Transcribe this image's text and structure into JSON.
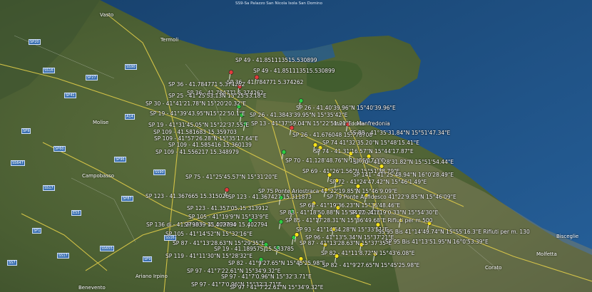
{
  "map": {
    "top_caption": "SS9-Sa Palazzo San Nicola Isola San Domino",
    "colors": {
      "sea": "#1f4f80",
      "land": "#4d6238",
      "road_yellow": "#e8d24a",
      "pin_green": "#2ecc40",
      "pin_red": "#e23b3b",
      "pin_yellow": "#f4e21a"
    },
    "towns": [
      {
        "id": "vasto",
        "text": "Vasto"
      },
      {
        "id": "termoli",
        "text": "Termoli"
      },
      {
        "id": "molise",
        "text": "Molise"
      },
      {
        "id": "campobasso",
        "text": "Campobasso"
      },
      {
        "id": "ariano",
        "text": "Ariano Irpino"
      },
      {
        "id": "benevento",
        "text": "Benevento"
      },
      {
        "id": "molfetta",
        "text": "Molfetta"
      },
      {
        "id": "corato",
        "text": "Corato"
      },
      {
        "id": "manfredonia",
        "text": "Manfredonia"
      },
      {
        "id": "bisceglie",
        "text": "Bisceglie"
      }
    ],
    "labels": [
      {
        "id": "l1",
        "text": "SP 49 - 41.851113515.530899"
      },
      {
        "id": "l2",
        "text": "SP 49 - 41.851113515.530899"
      },
      {
        "id": "l3",
        "text": "SP 36 - 41.784771 5.374262"
      },
      {
        "id": "l4",
        "text": "SP 36 - 41.784771 5.374262"
      },
      {
        "id": "l5",
        "text": "SP 36 - 41.784771 5.374262"
      },
      {
        "id": "l6",
        "text": "SP 25 - 41°25'53.13N 15°25'53.18\"E"
      },
      {
        "id": "l7",
        "text": "SP 30 - 41°41'21.78\"N 15°20'20.32\"E"
      },
      {
        "id": "l8",
        "text": "SP 26 - 41.40'39.96\"N 15°40'39.96\"E"
      },
      {
        "id": "l9",
        "text": "SP 19 - 41°39'43.95\"N15°22'50.1\"E"
      },
      {
        "id": "l10",
        "text": "SP 26 - 41.3843'39.95\"N 15°35'42\"E"
      },
      {
        "id": "l11",
        "text": "SP 19 - 41°31'45.05\"N 15°22'37.55\"E"
      },
      {
        "id": "l12",
        "text": "SP 13 - 41°37'59.04\"N 15°22'51.21\"E"
      },
      {
        "id": "l13",
        "text": "Manfredonia"
      },
      {
        "id": "l14",
        "text": "SP 109 - 41.581683 15.359703"
      },
      {
        "id": "l15",
        "text": "SP 26 - 41.676048 15.778708"
      },
      {
        "id": "l16",
        "text": "SS 88 - 41°35'31.84\"N 15°51'47.34\"E"
      },
      {
        "id": "l17",
        "text": "SP 109 - 41°57'26.28\"N 15°35'17.64\"E"
      },
      {
        "id": "l18",
        "text": "SP 109 - 41.585416 15.360139"
      },
      {
        "id": "l19",
        "text": "SP 74 41°32'35.20\"N 15°48'15.41\"E"
      },
      {
        "id": "l20",
        "text": "SP 109 - 41.556217 15.348979"
      },
      {
        "id": "l21",
        "text": "SP 74 - 41.31'16.57\"N 15°44'17.87\"E"
      },
      {
        "id": "l22",
        "text": "SP 70 - 41.128'48.76\"N 15°55'17.3\"E"
      },
      {
        "id": "l23",
        "text": "SP 70 - 41°28'31.82\"N 15°51'54.44\"E"
      },
      {
        "id": "l24",
        "text": "SP 69 - 41°26'1.56\"N 15°51'38.79\"E"
      },
      {
        "id": "l25",
        "text": "SP 75 - 41°25'45.57\"N 15°31'20\"E"
      },
      {
        "id": "l26",
        "text": "SP 141 - 41°25'48.94\"N 16°0'28.49\"E"
      },
      {
        "id": "l27",
        "text": "SP 72 - 41°24'47.42\"N 15°46'1.49\"E"
      },
      {
        "id": "l28",
        "text": "SP 75 Ponte Ariostraca 41°22'19.85\"N 15°46'9.09\"E"
      },
      {
        "id": "l29",
        "text": "SP 123 - 41.367665 15.315026"
      },
      {
        "id": "l30",
        "text": "SP 123 - 41.367427 15.311873"
      },
      {
        "id": "l31",
        "text": "SP 79 Ponte Aufidesco 41°22'9.85\"N 15°46'09\"E"
      },
      {
        "id": "l32",
        "text": "SP 68 - 41°19'36.23\"N 15°36'48.46\"E"
      },
      {
        "id": "l33",
        "text": "SP 123 - 41.357'05.15 313912"
      },
      {
        "id": "l34",
        "text": "SP 83 - 41°18'50.88\"N 15°44'20.21\"E"
      },
      {
        "id": "l35",
        "text": "SP 77 - 41°19'0.33\"N 15°54'30\"E"
      },
      {
        "id": "l36",
        "text": "SP 105 - 41°19'9\"N 15°33'9\"E"
      },
      {
        "id": "l37",
        "text": "SP 85 - 41°17'28.31\"N 15°36'49.68\"E Rifiuti per m 500"
      },
      {
        "id": "l38",
        "text": "SP 105 - 41.279839 15.402794"
      },
      {
        "id": "l39",
        "text": "SP 136 di - 41.279839 15.402794"
      },
      {
        "id": "l40",
        "text": "SP 93 - 41°14'54.28\"N 15°33'51\"E"
      },
      {
        "id": "l41",
        "text": "SS 95 Bis 41°14'49.74\"N 15°55'16.3\"E Rifiuti per m. 130"
      },
      {
        "id": "l42",
        "text": "SP 105 - 41°14'52\"N 15°32'16\"E"
      },
      {
        "id": "l43",
        "text": "SP 96 - 41°13'5.34\"N 15°37'21\"E"
      },
      {
        "id": "l44",
        "text": "SP 87 - 41°13'28.63\"N 15°29'35\"E"
      },
      {
        "id": "l45",
        "text": "SP 87 - 41°13'28.63\"N 15°37'35\"E"
      },
      {
        "id": "l46",
        "text": "SP 95 Bis 41°13'51.95\"N 16°0'53.39\"E"
      },
      {
        "id": "l47",
        "text": "SP 19 - 41.189575 15.533785"
      },
      {
        "id": "l48",
        "text": "SP 82 - 41°11'8.72\"N 15°43'6.08\"E"
      },
      {
        "id": "l49",
        "text": "SP 119 - 41°11'30\"N 15°28'32\"E"
      },
      {
        "id": "l50",
        "text": "SP 82 - 41°9'27.65\"N 15°45'25.98\"E"
      },
      {
        "id": "l51",
        "text": "SP 82 - 41°9'27.65\"N 15°45'25.98\"E"
      },
      {
        "id": "l52",
        "text": "SP 97 - 41°7'22.61\"N 15°34'9.32\"E"
      },
      {
        "id": "l53",
        "text": "SP 97 - 41°7'0.96\"N 15°32'3.71\"E"
      },
      {
        "id": "l54",
        "text": "SP 97 - 41°7'0.96\"N 15°32'3.71\"E"
      },
      {
        "id": "l55",
        "text": "SP 97 - 41°7'22.61\"N 15°34'9.32\"E"
      }
    ],
    "shields": [
      "SP20",
      "SS16",
      "SP41",
      "SP9",
      "SP60",
      "SS647",
      "SP96",
      "SS90",
      "SS17",
      "SP87",
      "E55",
      "SP1",
      "SS655",
      "SS17",
      "SP9",
      "SS7",
      "SP27",
      "SS90",
      "A14",
      "SS16"
    ]
  }
}
